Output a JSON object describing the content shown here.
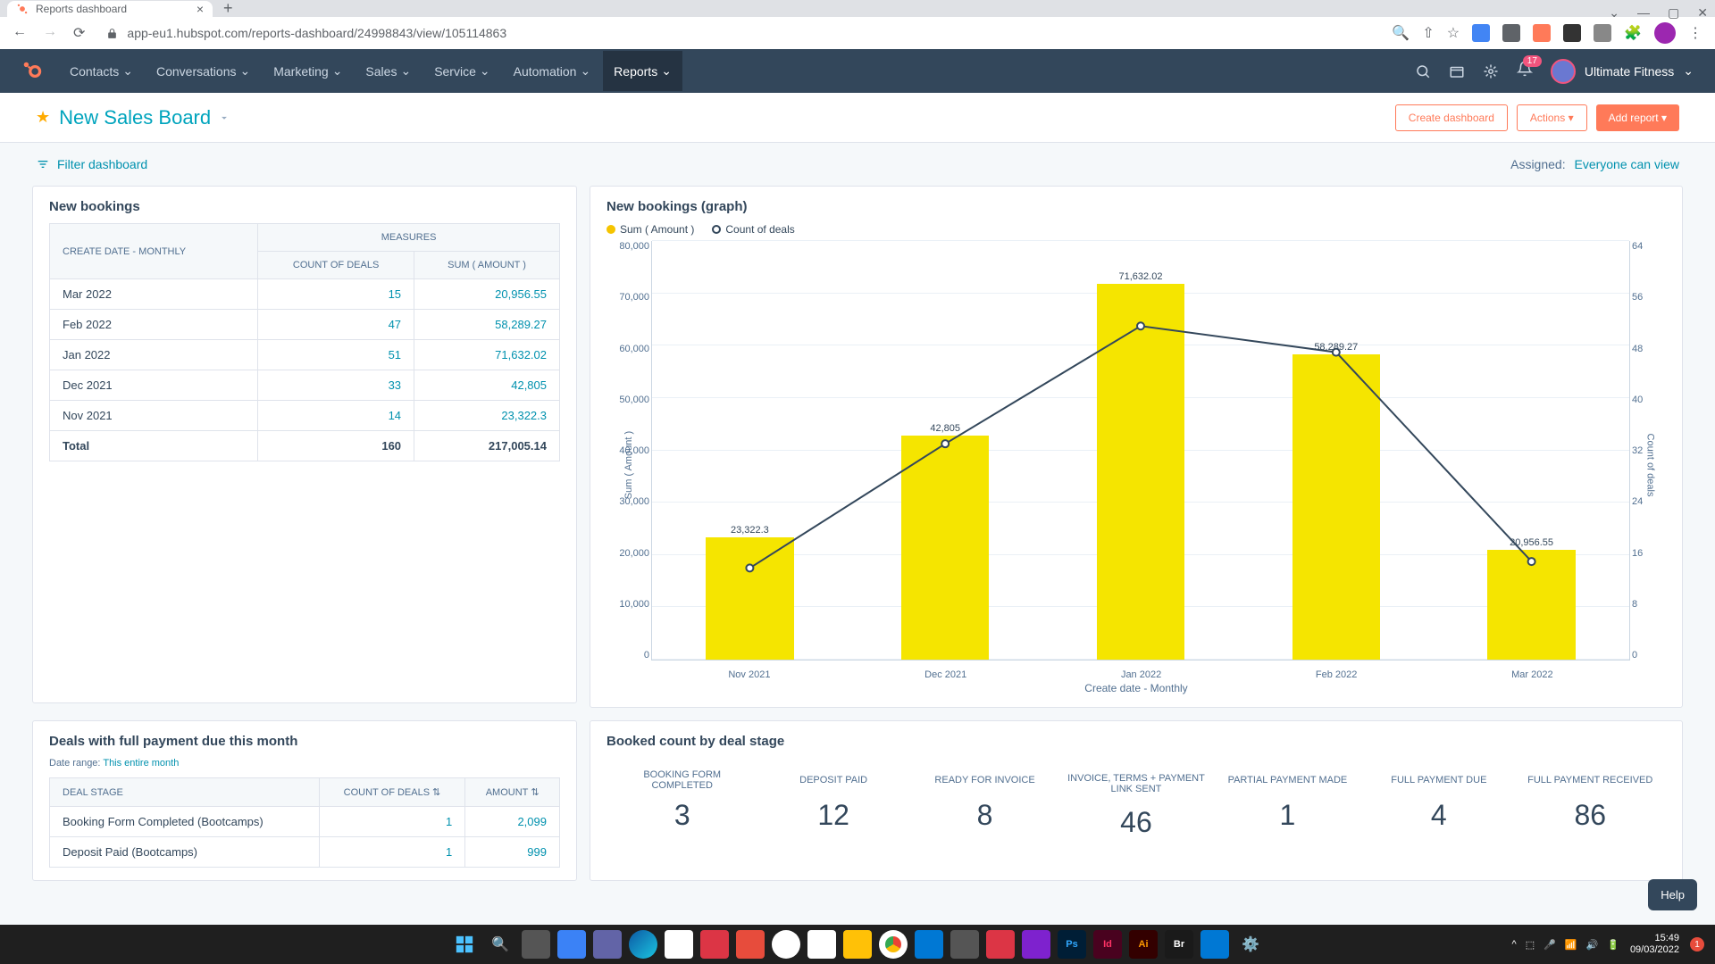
{
  "browser": {
    "tab_title": "Reports dashboard",
    "url": "app-eu1.hubspot.com/reports-dashboard/24998843/view/105114863"
  },
  "nav": {
    "items": [
      "Contacts",
      "Conversations",
      "Marketing",
      "Sales",
      "Service",
      "Automation",
      "Reports"
    ],
    "notif_count": "17",
    "account": "Ultimate Fitness"
  },
  "dash": {
    "title": "New Sales Board",
    "create_btn": "Create dashboard",
    "actions_btn": "Actions",
    "add_btn": "Add report",
    "filter_link": "Filter dashboard",
    "assigned_label": "Assigned:",
    "assigned_val": "Everyone can view"
  },
  "table": {
    "title": "New bookings",
    "col_period": "CREATE DATE - MONTHLY",
    "col_measures": "MEASURES",
    "col_count": "COUNT OF DEALS",
    "col_sum": "SUM ( AMOUNT )",
    "rows": [
      {
        "period": "Mar 2022",
        "count": "15",
        "sum": "20,956.55"
      },
      {
        "period": "Feb 2022",
        "count": "47",
        "sum": "58,289.27"
      },
      {
        "period": "Jan 2022",
        "count": "51",
        "sum": "71,632.02"
      },
      {
        "period": "Dec 2021",
        "count": "33",
        "sum": "42,805"
      },
      {
        "period": "Nov 2021",
        "count": "14",
        "sum": "23,322.3"
      }
    ],
    "total_label": "Total",
    "total_count": "160",
    "total_sum": "217,005.14"
  },
  "chart_data": {
    "type": "bar",
    "title": "New bookings (graph)",
    "legend": {
      "bar": "Sum ( Amount )",
      "line": "Count of deals"
    },
    "categories": [
      "Nov 2021",
      "Dec 2021",
      "Jan 2022",
      "Feb 2022",
      "Mar 2022"
    ],
    "series": [
      {
        "name": "Sum ( Amount )",
        "axis": "left",
        "type": "bar",
        "values": [
          23322.3,
          42805,
          71632.02,
          58289.27,
          20956.55
        ],
        "labels": [
          "23,322.3",
          "42,805",
          "71,632.02",
          "58,289.27",
          "20,956.55"
        ]
      },
      {
        "name": "Count of deals",
        "axis": "right",
        "type": "line",
        "values": [
          14,
          33,
          51,
          47,
          15
        ]
      }
    ],
    "ylim_left": [
      0,
      80000
    ],
    "ylim_right": [
      0,
      64
    ],
    "yticks_left": [
      "80,000",
      "70,000",
      "60,000",
      "50,000",
      "40,000",
      "30,000",
      "20,000",
      "10,000",
      "0"
    ],
    "yticks_right": [
      "64",
      "56",
      "48",
      "40",
      "32",
      "24",
      "16",
      "8",
      "0"
    ],
    "xlabel": "Create date - Monthly",
    "ylabel_left": "Sum ( Amount )",
    "ylabel_right": "Count of deals"
  },
  "deals": {
    "title": "Deals with full payment due this month",
    "range_label": "Date range:",
    "range_val": "This entire month",
    "cols": {
      "stage": "DEAL STAGE",
      "count": "COUNT OF DEALS",
      "amount": "AMOUNT"
    },
    "rows": [
      {
        "stage": "Booking Form Completed (Bootcamps)",
        "count": "1",
        "amount": "2,099"
      },
      {
        "stage": "Deposit Paid (Bootcamps)",
        "count": "1",
        "amount": "999"
      }
    ]
  },
  "stages": {
    "title": "Booked count by deal stage",
    "items": [
      {
        "label": "BOOKING FORM COMPLETED",
        "val": "3"
      },
      {
        "label": "DEPOSIT PAID",
        "val": "12"
      },
      {
        "label": "READY FOR INVOICE",
        "val": "8"
      },
      {
        "label": "INVOICE, TERMS + PAYMENT LINK SENT",
        "val": "46"
      },
      {
        "label": "PARTIAL PAYMENT MADE",
        "val": "1"
      },
      {
        "label": "FULL PAYMENT DUE",
        "val": "4"
      },
      {
        "label": "FULL PAYMENT RECEIVED",
        "val": "86"
      }
    ]
  },
  "help": "Help",
  "clock": {
    "time": "15:49",
    "date": "09/03/2022"
  }
}
